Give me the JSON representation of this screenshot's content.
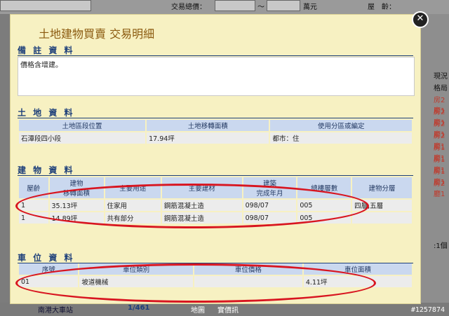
{
  "background": {
    "top_filter_label": "交易總價：",
    "top_unit": "萬元",
    "top_age_label": "屋　齡：",
    "top_tilde": "～",
    "right_items": [
      "現況",
      "格局",
      "房2廳1",
      "房2廳1",
      "房2廳1",
      "房2廳1",
      "房1廳1",
      "房1廳1",
      "房1廳1",
      "房2廳1"
    ],
    "right_count": ":1個",
    "bottom_left": "南港大車站",
    "bottom_page": "1/461",
    "bottom_map": "地圖",
    "bottom_photo": "實價訊"
  },
  "modal": {
    "title": "土地建物買賣  交易明細",
    "close_symbol": "✕",
    "notes": {
      "heading": "備 註 資 料",
      "text": "價格含增建。"
    },
    "land": {
      "heading": "土 地 資 料",
      "columns": [
        "土地區段位置",
        "土地移轉面積",
        "使用分區或編定"
      ],
      "rows": [
        [
          "石潭段四小段",
          "17.94坪",
          "都市：住"
        ]
      ]
    },
    "building": {
      "heading": "建 物 資 料",
      "columns": [
        "屋齡",
        "建物\n移轉面積",
        "主要用途",
        "主要建材",
        "建築\n完成年月",
        "總樓層數",
        "建物分層"
      ],
      "rows": [
        [
          "1",
          "35.13坪",
          "住家用",
          "鋼筋混凝土造",
          "098/07",
          "005",
          "四層,五層"
        ],
        [
          "1",
          "14.89坪",
          "共有部分",
          "鋼筋混凝土造",
          "098/07",
          "005",
          ""
        ]
      ]
    },
    "parking": {
      "heading": "車 位 資 料",
      "columns": [
        "序號",
        "車位類別",
        "車位價格",
        "車位面積"
      ],
      "rows": [
        [
          "01",
          "坡道機械",
          "",
          "4.11坪"
        ]
      ]
    }
  },
  "watermark": "#1257874",
  "colors": {
    "modal_bg": "#f7f1c2",
    "header_blue": "#cad8ef",
    "section_text": "#1d3f7a",
    "title": "#8b5a0f",
    "annotation_red": "#d81520"
  }
}
